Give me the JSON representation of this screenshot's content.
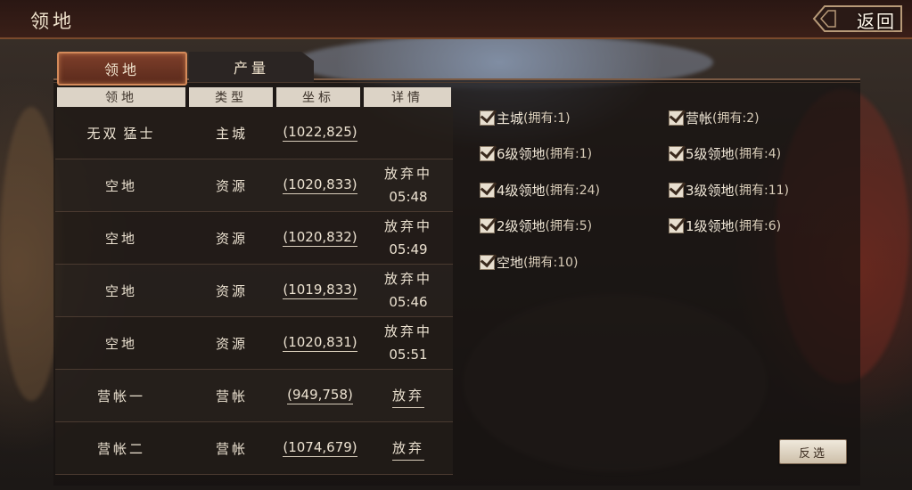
{
  "header": {
    "title": "领地",
    "back_label": "返回"
  },
  "tabs": [
    {
      "label": "领地",
      "active": true
    },
    {
      "label": "产量",
      "active": false
    }
  ],
  "table": {
    "columns": [
      "领地",
      "类型",
      "坐标",
      "详情"
    ],
    "rows": [
      {
        "name_a": "无双",
        "name_b": "猛士",
        "type": "主城",
        "coord": "(1022,825)",
        "status": "",
        "time": "",
        "action": ""
      },
      {
        "name": "空地",
        "type": "资源",
        "coord": "(1020,833)",
        "status": "放弃中",
        "time": "05:48",
        "action": ""
      },
      {
        "name": "空地",
        "type": "资源",
        "coord": "(1020,832)",
        "status": "放弃中",
        "time": "05:49",
        "action": ""
      },
      {
        "name": "空地",
        "type": "资源",
        "coord": "(1019,833)",
        "status": "放弃中",
        "time": "05:46",
        "action": ""
      },
      {
        "name": "空地",
        "type": "资源",
        "coord": "(1020,831)",
        "status": "放弃中",
        "time": "05:51",
        "action": ""
      },
      {
        "name": "营帐一",
        "type": "营帐",
        "coord": "(949,758)",
        "status": "",
        "time": "",
        "action": "放弃"
      },
      {
        "name": "营帐二",
        "type": "营帐",
        "coord": "(1074,679)",
        "status": "",
        "time": "",
        "action": "放弃"
      }
    ]
  },
  "filters": [
    {
      "label": "主城",
      "count": "(拥有:1)",
      "checked": true
    },
    {
      "label": "营帐",
      "count": "(拥有:2)",
      "checked": true
    },
    {
      "label": "6级领地",
      "count": "(拥有:1)",
      "checked": true
    },
    {
      "label": "5级领地",
      "count": "(拥有:4)",
      "checked": true
    },
    {
      "label": "4级领地",
      "count": "(拥有:24)",
      "checked": true
    },
    {
      "label": "3级领地",
      "count": "(拥有:11)",
      "checked": true
    },
    {
      "label": "2级领地",
      "count": "(拥有:5)",
      "checked": true
    },
    {
      "label": "1级领地",
      "count": "(拥有:6)",
      "checked": true
    },
    {
      "label": "空地",
      "count": "(拥有:10)",
      "checked": true
    }
  ],
  "invert_button": "反选",
  "colors": {
    "accent": "#d48a5a",
    "text": "#ece2d1",
    "header_bg": "#dcd3c6"
  }
}
